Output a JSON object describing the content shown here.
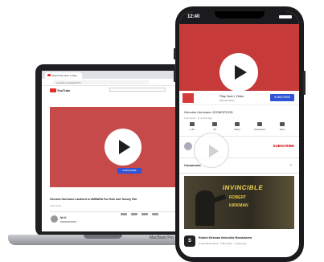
{
  "laptop": {
    "tab_title": "Watch Play New | Video",
    "url": "youtube.com/watch?v=",
    "logo_text": "YouTube",
    "subscribe_label": "SUBSCRIBE",
    "video_title": "Genuine Hurricane Landlord in UMMARA Fox Hole and Yummy Fair",
    "video_meta": "1.4K views",
    "channel_name": "Mr K",
    "brand": "MacBook Pro"
  },
  "phone": {
    "time": "12:40",
    "banner": {
      "title": "Play Now | Video",
      "subtitle": "Play Ad Music",
      "button": "SUBSCRIBE"
    },
    "video_title": "Genuine Hurricane JOOMSPOOD",
    "video_meta": "1.4k views · 3 months ago",
    "actions": [
      {
        "label": "1.4k"
      },
      {
        "label": "29"
      },
      {
        "label": "Share"
      },
      {
        "label": "Download"
      },
      {
        "label": "Save"
      }
    ],
    "subscribe": "SUBSCRIBE",
    "comments_label": "Comments",
    "thumbnail": {
      "title": "INVINCIBLE",
      "line1": "ROBERT",
      "line2": "KIRKMAN"
    },
    "recommended": {
      "badge": "S",
      "title": "Robert Kirkman Invincible Remastered",
      "meta": "Comic Book Show · 5.8K views · 1 week ago"
    }
  }
}
